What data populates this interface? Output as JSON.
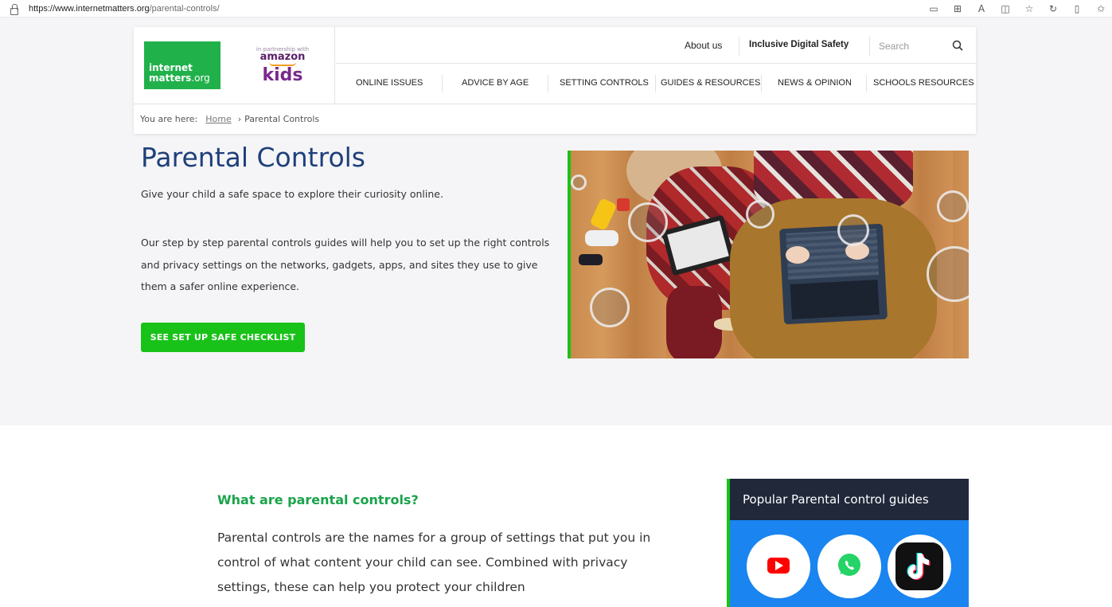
{
  "browser": {
    "url_host": "https://www.internetmatters.org",
    "url_path": "/parental-controls/"
  },
  "logo": {
    "line1": "internet",
    "line2": "matters",
    "line2_suffix": ".org",
    "partner_prefix": "in partnership with",
    "partner_brand": "amazon",
    "partner_kids": "kids"
  },
  "top_nav": {
    "about": "About us",
    "inclusive": "Inclusive Digital Safety",
    "search_placeholder": "Search"
  },
  "main_nav": [
    "ONLINE ISSUES",
    "ADVICE BY AGE",
    "SETTING CONTROLS",
    "GUIDES & RESOURCES",
    "NEWS & OPINION",
    "SCHOOLS RESOURCES"
  ],
  "breadcrumb": {
    "prefix": "You are here:",
    "home": "Home",
    "separator": "›",
    "current": "Parental Controls"
  },
  "hero": {
    "title": "Parental Controls",
    "intro": "Give your child a safe space to explore their curiosity online.",
    "description": "Our step by step parental controls guides will help you to set up the right controls and privacy settings on the networks, gadgets, apps, and sites they use to give them a safer online experience.",
    "cta": "SEE SET UP SAFE CHECKLIST"
  },
  "section": {
    "heading": "What are parental controls?",
    "body": "Parental controls are the names for a group of settings that put you in control of what content your child can see. Combined with privacy settings, these can help you protect your children"
  },
  "guides": {
    "title": "Popular Parental control guides",
    "items": [
      "youtube-icon",
      "whatsapp-icon",
      "tiktok-icon"
    ]
  },
  "colors": {
    "brand_green": "#19c219",
    "title_blue": "#1f3f7a",
    "guides_blue": "#1a84f0",
    "guides_dark": "#20283a"
  }
}
